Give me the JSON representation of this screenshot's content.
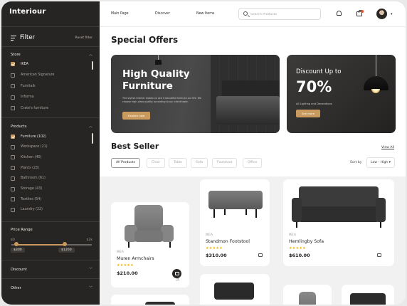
{
  "app": {
    "logo": "Interiour"
  },
  "sidebar": {
    "filter_title": "Filter",
    "reset_label": "Reset filter",
    "store": {
      "title": "Store",
      "options": [
        {
          "label": "IKEA",
          "checked": true
        },
        {
          "label": "American Signature",
          "checked": false
        },
        {
          "label": "Furnitalk",
          "checked": false
        },
        {
          "label": "Informa",
          "checked": false
        },
        {
          "label": "Crate's furniture",
          "checked": false
        }
      ]
    },
    "products": {
      "title": "Products",
      "options": [
        {
          "label": "Furniture (102)",
          "checked": true
        },
        {
          "label": "Workspace (21)",
          "checked": false
        },
        {
          "label": "Kitchen (40)",
          "checked": false
        },
        {
          "label": "Plants (23)",
          "checked": false
        },
        {
          "label": "Bathroom (61)",
          "checked": false
        },
        {
          "label": "Storage (43)",
          "checked": false
        },
        {
          "label": "Textiles (54)",
          "checked": false
        },
        {
          "label": "Laundry (22)",
          "checked": false
        }
      ]
    },
    "price_range": {
      "title": "Price Range",
      "min_label": "$0",
      "max_label": "$2k",
      "low_value": "$300",
      "high_value": "$1200"
    },
    "discount_title": "Discount",
    "other_title": "Other"
  },
  "header": {
    "nav": [
      "Main Page",
      "Discover",
      "New Items"
    ],
    "search_placeholder": "Search Products"
  },
  "main": {
    "special_offers_title": "Special Offers",
    "banner_main": {
      "title": "High Quality Furniture",
      "description": "The stylish interior makes us see it beautiful forms to our life. We choose high-class quality according to our client taste.",
      "button": "Explore now"
    },
    "banner_discount": {
      "title": "Discount Up to",
      "value": "70%",
      "subtitle": "All Lighting and Decorations",
      "button": "See more"
    },
    "best_seller_title": "Best Seller",
    "view_all": "View All",
    "chips": [
      "All Products",
      "Chair",
      "Table",
      "Sofa",
      "Footstool",
      "Office"
    ],
    "sort_label": "Sort by",
    "sort_value": "Low - High",
    "products": [
      {
        "brand": "IKEA",
        "name": "Muren Armchairs",
        "stars": "★★★★★",
        "price": "$210.00"
      },
      {
        "brand": "IKEA",
        "name": "Standmon Footstool",
        "stars": "★★★★★",
        "price": "$310.00"
      },
      {
        "brand": "IKEA",
        "name": "Hemlingby Sofa",
        "stars": "★★★★★",
        "price": "$610.00"
      }
    ]
  },
  "colors": {
    "accent": "#c99a5e",
    "sidebar": "#272523",
    "star": "#e8b400"
  }
}
